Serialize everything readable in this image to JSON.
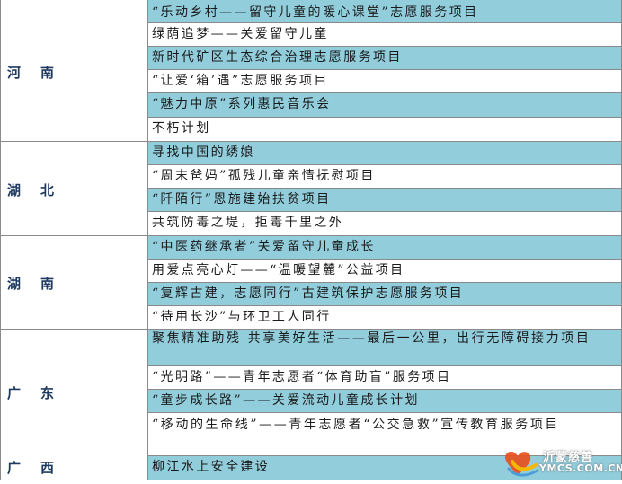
{
  "provinces": [
    {
      "name": "河南",
      "rows": [
        {
          "text": "“乐动乡村——留守儿童的暖心课堂”志愿服务项目",
          "color": "cyan"
        },
        {
          "text": "绿荫追梦——关爱留守儿童",
          "color": "white"
        },
        {
          "text": "新时代矿区生态综合治理志愿服务项目",
          "color": "cyan"
        },
        {
          "text": "“让爱‘箱’遇”志愿服务项目",
          "color": "white"
        },
        {
          "text": "“魅力中原”系列惠民音乐会",
          "color": "cyan"
        },
        {
          "text": "不朽计划",
          "color": "white"
        }
      ]
    },
    {
      "name": "湖北",
      "rows": [
        {
          "text": "寻找中国的绣娘",
          "color": "cyan"
        },
        {
          "text": "“周末爸妈”孤残儿童亲情抚慰项目",
          "color": "white"
        },
        {
          "text": "“阡陌行”恩施建始扶贫项目",
          "color": "cyan"
        },
        {
          "text": "共筑防毒之堤，拒毒千里之外",
          "color": "white"
        }
      ]
    },
    {
      "name": "湖南",
      "rows": [
        {
          "text": "“中医药继承者”关爱留守儿童成长",
          "color": "cyan"
        },
        {
          "text": "用爱点亮心灯——“温暖望麓”公益项目",
          "color": "white"
        },
        {
          "text": "“复辉古建，志愿同行”古建筑保护志愿服务项目",
          "color": "cyan"
        },
        {
          "text": "“待用长沙”与环卫工人同行",
          "color": "white"
        }
      ]
    },
    {
      "name": "广东",
      "rows": [
        {
          "text": "聚焦精准助残 共享美好生活——最后一公里，出行无障碍接力项目",
          "color": "cyan"
        },
        {
          "text": "“光明路”——青年志愿者“体育助盲”服务项目",
          "color": "white"
        },
        {
          "text": "“童步成长路”——关爱流动儿童成长计划",
          "color": "cyan"
        },
        {
          "text": "“移动的生命线”——青年志愿者“公交急救”宣传教育服务项目",
          "color": "white"
        }
      ]
    },
    {
      "name": "广西",
      "rows": [
        {
          "text": "柳江水上安全建设",
          "color": "cyan"
        }
      ]
    }
  ],
  "watermark": {
    "cn": "沂蒙慈善",
    "en": "YMCS.COM.CN",
    "logo": "heart-logo"
  },
  "colors": {
    "cyan": "#92cddc",
    "white": "#ffffff",
    "label": "#1f3a5f",
    "grid": "#8a8a8a"
  }
}
